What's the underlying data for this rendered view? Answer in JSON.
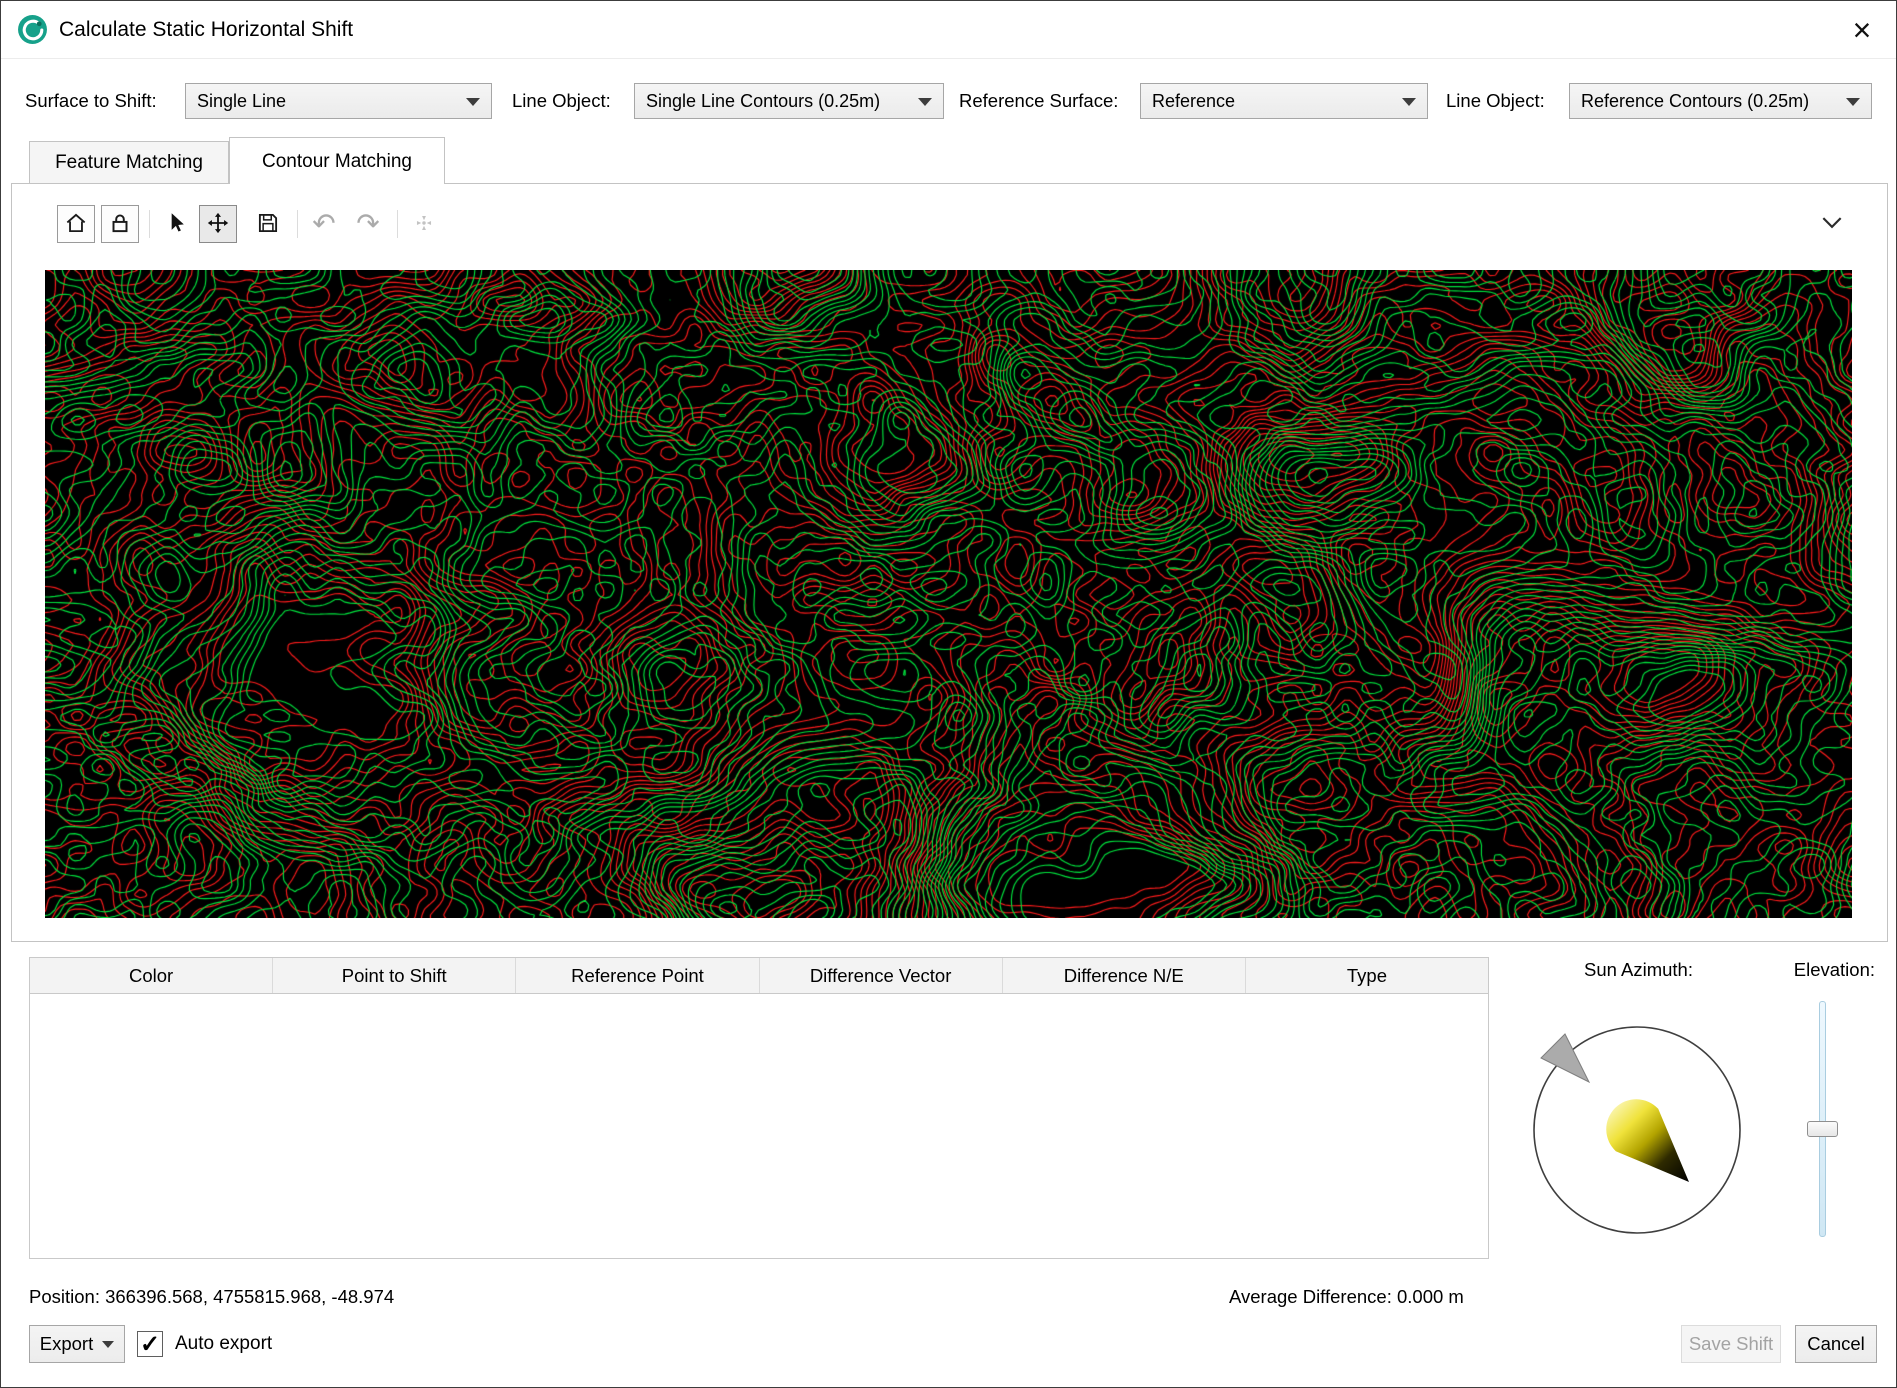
{
  "window": {
    "title": "Calculate Static Horizontal Shift",
    "close": "×"
  },
  "filters": {
    "surface_to_shift_label": "Surface to Shift:",
    "surface_to_shift_value": "Single Line",
    "line_object_label": "Line Object:",
    "line_object_value": "Single Line Contours (0.25m)",
    "reference_surface_label": "Reference Surface:",
    "reference_surface_value": "Reference",
    "ref_line_object_label": "Line Object:",
    "ref_line_object_value": "Reference Contours (0.25m)"
  },
  "tabs": {
    "feature_matching": "Feature Matching",
    "contour_matching": "Contour Matching"
  },
  "icons": {
    "undo": "↶",
    "redo": "↷",
    "check": "✓"
  },
  "table": {
    "headers": [
      "Color",
      "Point to Shift",
      "Reference Point",
      "Difference Vector",
      "Difference N/E",
      "Type"
    ],
    "rows": []
  },
  "sun": {
    "azimuth_label": "Sun Azimuth:",
    "elevation_label": "Elevation:"
  },
  "status": {
    "position": "Position: 366396.568, 4755815.968, -48.974",
    "average_difference": "Average Difference: 0.000 m"
  },
  "footer": {
    "export": "Export",
    "auto_export": "Auto export",
    "auto_export_checked": true,
    "save_shift": "Save Shift",
    "cancel": "Cancel"
  },
  "map": {
    "background": "#000000",
    "reference_color": "#ff1c1c",
    "shifted_color": "#00e63e"
  }
}
